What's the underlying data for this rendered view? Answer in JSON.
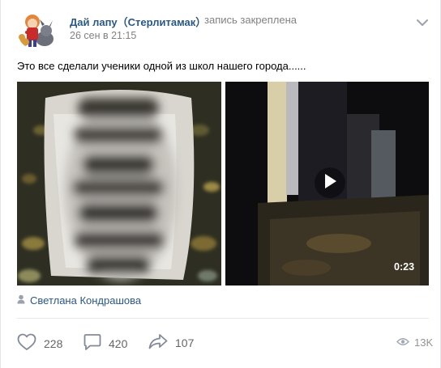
{
  "post": {
    "author_name": "Дай лапу（Стерлитамак）",
    "pinned_text": "запись закреплена",
    "date": "26 сен в 21:15",
    "text": "Это все сделали ученики одной из школ нашего города......",
    "video_duration": "0:23",
    "signer": "Светлана Кондрашова"
  },
  "actions": {
    "likes": "228",
    "comments": "420",
    "shares": "107",
    "views": "13K"
  },
  "colors": {
    "link": "#2a5885",
    "meta": "#828282",
    "action": "#656565"
  },
  "icons": [
    "more-icon",
    "play-icon",
    "person-icon",
    "heart-icon",
    "comment-icon",
    "share-icon",
    "eye-icon"
  ]
}
